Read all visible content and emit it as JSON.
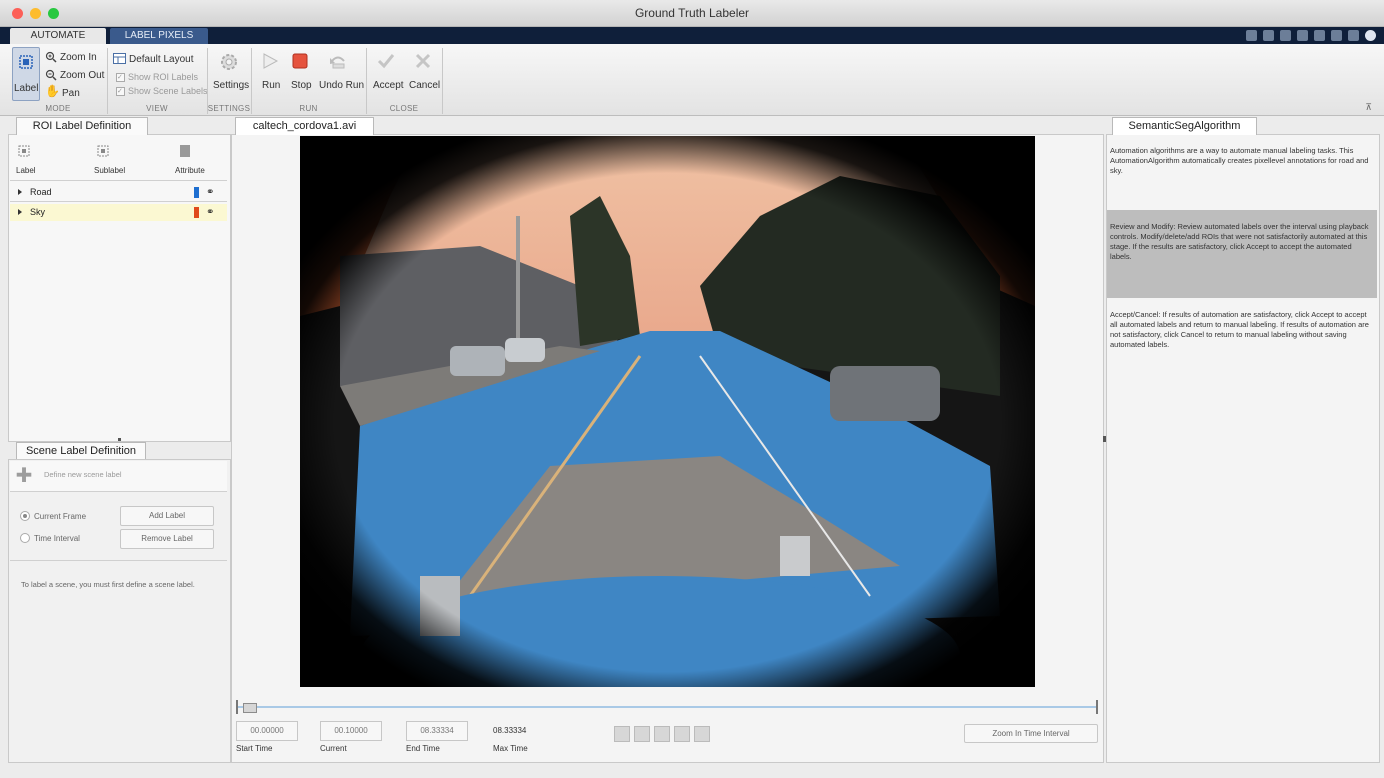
{
  "window": {
    "title": "Ground Truth Labeler"
  },
  "toolstrip": {
    "tabs": [
      {
        "label": "AUTOMATE"
      },
      {
        "label": "LABEL PIXELS"
      }
    ]
  },
  "ribbon": {
    "mode": {
      "label_btn": "Label",
      "zoom_in": "Zoom In",
      "zoom_out": "Zoom Out",
      "pan": "Pan",
      "group": "MODE"
    },
    "view": {
      "default_layout": "Default Layout",
      "show_roi": "Show ROI Labels",
      "show_scene": "Show Scene Labels",
      "group": "VIEW"
    },
    "settings": {
      "label": "Settings",
      "group": "SETTINGS"
    },
    "run": {
      "run": "Run",
      "stop": "Stop",
      "undo_run": "Undo Run",
      "group": "RUN"
    },
    "close": {
      "accept": "Accept",
      "cancel": "Cancel",
      "group": "CLOSE"
    }
  },
  "roi_panel": {
    "tab": "ROI Label Definition",
    "tools": {
      "label": "Label",
      "sublabel": "Sublabel",
      "attribute": "Attribute"
    },
    "labels": [
      {
        "name": "Road",
        "color": "#1e6fd0"
      },
      {
        "name": "Sky",
        "color": "#e04a1a"
      }
    ]
  },
  "scene_panel": {
    "tab": "Scene Label Definition",
    "define": "Define new scene label",
    "current_frame": "Current Frame",
    "time_interval": "Time Interval",
    "add_label": "Add Label",
    "remove_label": "Remove Label",
    "hint": "To label a scene, you must first define a scene label."
  },
  "video": {
    "tab": "caltech_cordova1.avi",
    "start_time": "00.00000",
    "current": "00.10000",
    "end_time": "08.33334",
    "max_time": "08.33334",
    "start_caption": "Start Time",
    "current_caption": "Current",
    "end_caption": "End Time",
    "max_caption": "Max Time",
    "zoom_interval": "Zoom In Time Interval",
    "colors": {
      "sky_overlay": "#e9a98d",
      "road_overlay": "#3f86c4"
    }
  },
  "algorithm": {
    "tab": "SemanticSegAlgorithm",
    "intro": "Automation algorithms are a way to automate manual labeling tasks. This AutomationAlgorithm automatically creates pixellevel annotations for road and sky.",
    "review": "Review and Modify: Review automated labels over the interval using playback controls. Modify/delete/add ROIs that were not satisfactorily automated at this stage. If the results are satisfactory, click Accept to accept the automated labels.",
    "accept_cancel": "Accept/Cancel: If results of automation are satisfactory, click Accept to accept all automated labels and return to manual labeling. If results of automation are not satisfactory, click Cancel to return to manual labeling without saving automated labels."
  }
}
